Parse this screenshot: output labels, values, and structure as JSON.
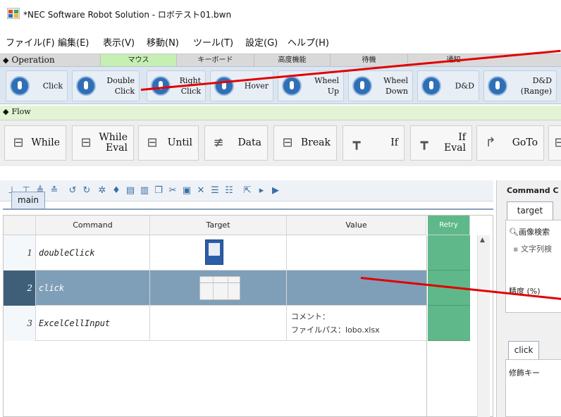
{
  "window": {
    "title": "*NEC Software Robot Solution - ロボテスト01.bwn"
  },
  "menu": {
    "items": [
      {
        "label": "ファイル(F)"
      },
      {
        "label": "編集(E)"
      },
      {
        "label": "表示(V)"
      },
      {
        "label": "移動(N)"
      },
      {
        "label": "ツール(T)"
      },
      {
        "label": "設定(G)"
      },
      {
        "label": "ヘルプ(H)"
      }
    ]
  },
  "ribbon": {
    "section_label": "Operation",
    "tabs": [
      {
        "label": "マウス",
        "active": true
      },
      {
        "label": "キーボード",
        "active": false
      },
      {
        "label": "高度機能",
        "active": false
      },
      {
        "label": "待機",
        "active": false
      },
      {
        "label": "通知",
        "active": false
      }
    ],
    "buttons": [
      {
        "label": "Click",
        "icon": "mouse-icon"
      },
      {
        "label": "Double\nClick",
        "icon": "mouse-icon"
      },
      {
        "label": "Right\nClick",
        "icon": "mouse-icon"
      },
      {
        "label": "Hover",
        "icon": "mouse-icon"
      },
      {
        "label": "Wheel\nUp",
        "icon": "mouse-icon"
      },
      {
        "label": "Wheel\nDown",
        "icon": "mouse-icon"
      },
      {
        "label": "D&D",
        "icon": "drag-icon"
      },
      {
        "label": "D&D\n(Range)",
        "icon": "drag-icon"
      }
    ]
  },
  "flow": {
    "section_label": "Flow",
    "buttons": [
      {
        "label": "While",
        "icon": "loop-icon"
      },
      {
        "label": "While\nEval",
        "icon": "loop-icon"
      },
      {
        "label": "Until",
        "icon": "loop-icon"
      },
      {
        "label": "Data",
        "icon": "data-icon"
      },
      {
        "label": "Break",
        "icon": "break-icon"
      },
      {
        "label": "If",
        "icon": "branch-icon"
      },
      {
        "label": "If\nEval",
        "icon": "branch-icon"
      },
      {
        "label": "GoTo",
        "icon": "goto-icon"
      }
    ]
  },
  "editor": {
    "tab": "main",
    "columns": {
      "command": "Command",
      "target": "Target",
      "value": "Value",
      "retry": "Retry"
    },
    "rows": [
      {
        "num": "1",
        "command": "doubleClick",
        "value": "",
        "selected": false
      },
      {
        "num": "2",
        "command": "click",
        "value": "",
        "selected": true
      },
      {
        "num": "3",
        "command": "ExcelCellInput",
        "value": "コメント：\nファイルパス：lobo.xlsx",
        "selected": false
      }
    ]
  },
  "right_panel": {
    "title": "Command C",
    "tab": "target",
    "row1": "画像検索",
    "row2": "文字列検",
    "row3": "精度 (%)",
    "tab2": "click",
    "row4": "修飾キー"
  },
  "colors": {
    "annotation": "#e10000",
    "retry": "#5fb889",
    "selected_row": "#7f9fb8"
  }
}
